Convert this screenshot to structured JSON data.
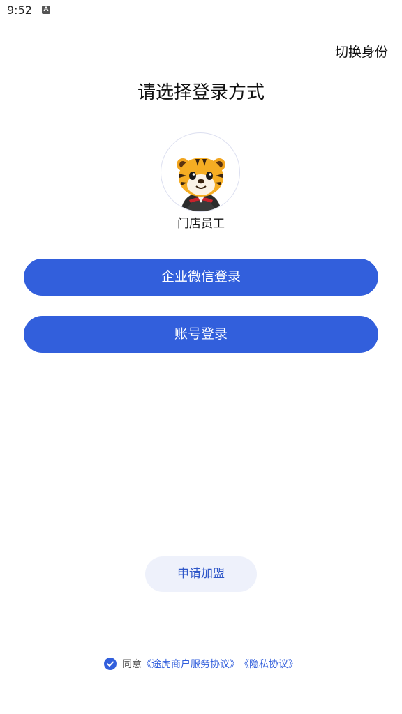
{
  "status_bar": {
    "time": "9:52",
    "notification_icon": "a-icon"
  },
  "header": {
    "switch_identity": "切换身份"
  },
  "main": {
    "title": "请选择登录方式",
    "role": {
      "label": "门店员工",
      "avatar_icon": "tiger-mascot-icon"
    },
    "wecom_login": "企业微信登录",
    "account_login": "账号登录",
    "apply_join": "申请加盟"
  },
  "agreement": {
    "prefix": "同意",
    "service_link": "《途虎商户服务协议》",
    "privacy_link": "《隐私协议》",
    "checked": true
  },
  "colors": {
    "primary": "#325fdc",
    "apply_bg": "#eef1fb"
  }
}
